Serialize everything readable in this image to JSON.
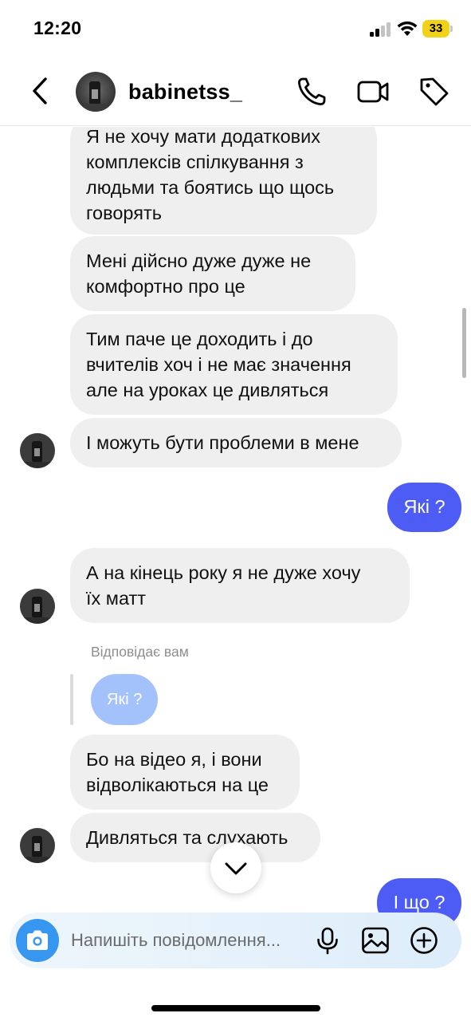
{
  "status_bar": {
    "time": "12:20",
    "battery": "33"
  },
  "header": {
    "username": "babinetss_",
    "icons": [
      "chevron-left-icon",
      "phone-icon",
      "video-camera-icon",
      "tag-icon"
    ]
  },
  "messages": [
    {
      "text": "Я не хочу мати додаткових\nкомплексів спілкування з\nлюдьми та боятись що щось\nговорять",
      "direction": "incoming"
    },
    {
      "text": "Мені дійсно дуже дуже не\nкомфортно про це",
      "direction": "incoming"
    },
    {
      "text": "Тим паче це доходить і до\nвчителів хоч і не має значення\nале на уроках це дивляться",
      "direction": "incoming"
    },
    {
      "text": "І можуть бути проблеми в мене",
      "direction": "incoming"
    },
    {
      "text": "Які ?",
      "direction": "outgoing"
    },
    {
      "text": "А на кінець року я не дуже хочу\nїх матт",
      "direction": "incoming"
    },
    {
      "text": "Бо на відео я, і вони\nвідволікаються на це",
      "direction": "incoming"
    },
    {
      "text": "Дивляться та слухають",
      "direction": "incoming"
    },
    {
      "text": "І що ?",
      "direction": "outgoing"
    }
  ],
  "reply": {
    "label": "Відповідає вам",
    "quoted": "Які ?"
  },
  "composer": {
    "placeholder": "Напишіть повідомлення...",
    "icons": [
      "camera-icon",
      "microphone-icon",
      "image-icon",
      "plus-circle-icon"
    ]
  },
  "colors": {
    "outgoing_bubble": "#4e5cf6",
    "incoming_bubble": "#efeff0",
    "camera_button": "#3797f0",
    "reply_quote": "#a3c2fb",
    "battery": "#f2d218"
  }
}
